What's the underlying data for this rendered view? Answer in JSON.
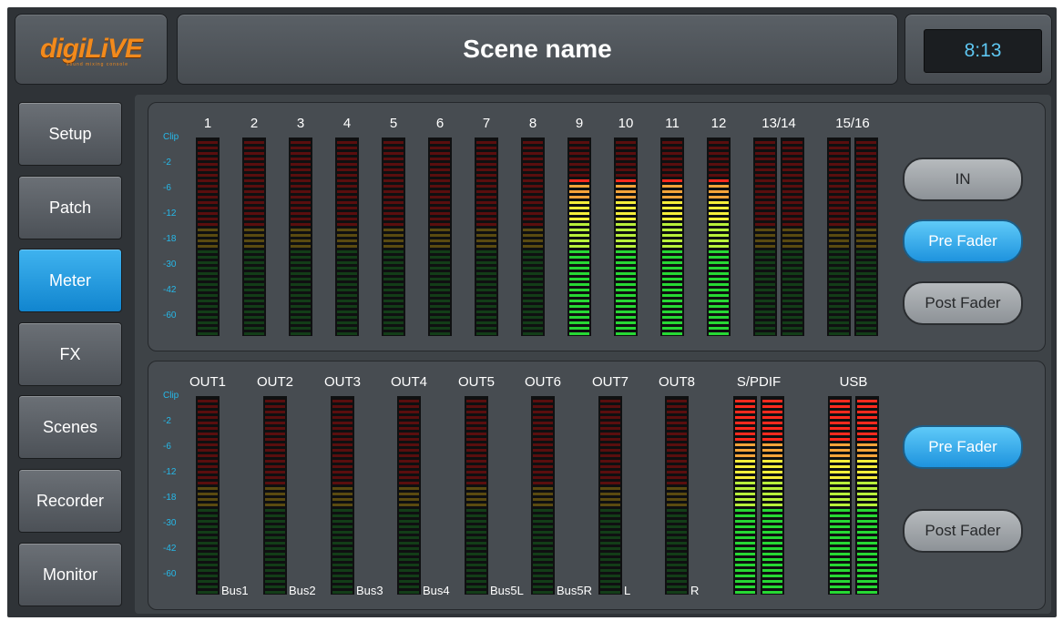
{
  "logo": {
    "brand": "digiLiVE",
    "tagline": "sound mixing console"
  },
  "header": {
    "title": "Scene name",
    "time": "8:13"
  },
  "nav": [
    "Setup",
    "Patch",
    "Meter",
    "FX",
    "Scenes",
    "Recorder",
    "Monitor"
  ],
  "active_nav": "Meter",
  "scale": [
    "Clip",
    "-2",
    "-6",
    "-12",
    "-18",
    "-30",
    "-42",
    "-60"
  ],
  "inputs": {
    "channels": [
      "1",
      "2",
      "3",
      "4",
      "5",
      "6",
      "7",
      "8",
      "9",
      "10",
      "11",
      "12",
      "13/14",
      "15/16"
    ],
    "levels": [
      0,
      0,
      0,
      0,
      0,
      0,
      0,
      0,
      0.8,
      0.8,
      0.8,
      0.8,
      0,
      0
    ],
    "buttons": {
      "in": "IN",
      "pre": "Pre Fader",
      "post": "Post Fader"
    },
    "selected": "Pre Fader"
  },
  "outputs": {
    "channels": [
      "OUT1",
      "OUT2",
      "OUT3",
      "OUT4",
      "OUT5",
      "OUT6",
      "OUT7",
      "OUT8",
      "S/PDIF",
      "USB"
    ],
    "assign": [
      "Bus1",
      "Bus2",
      "Bus3",
      "Bus4",
      "Bus5L",
      "Bus5R",
      "L",
      "R"
    ],
    "levels": [
      0,
      0,
      0,
      0,
      0,
      0,
      0,
      0,
      0.98,
      0.98
    ],
    "buttons": {
      "pre": "Pre Fader",
      "post": "Post Fader"
    },
    "selected": "Pre Fader"
  },
  "colors": {
    "accent": "#1e93de",
    "scale_text": "#26b8e8",
    "meter_red": "#ff2a1e",
    "meter_yellow": "#f5ee3a",
    "meter_green": "#27d834"
  }
}
